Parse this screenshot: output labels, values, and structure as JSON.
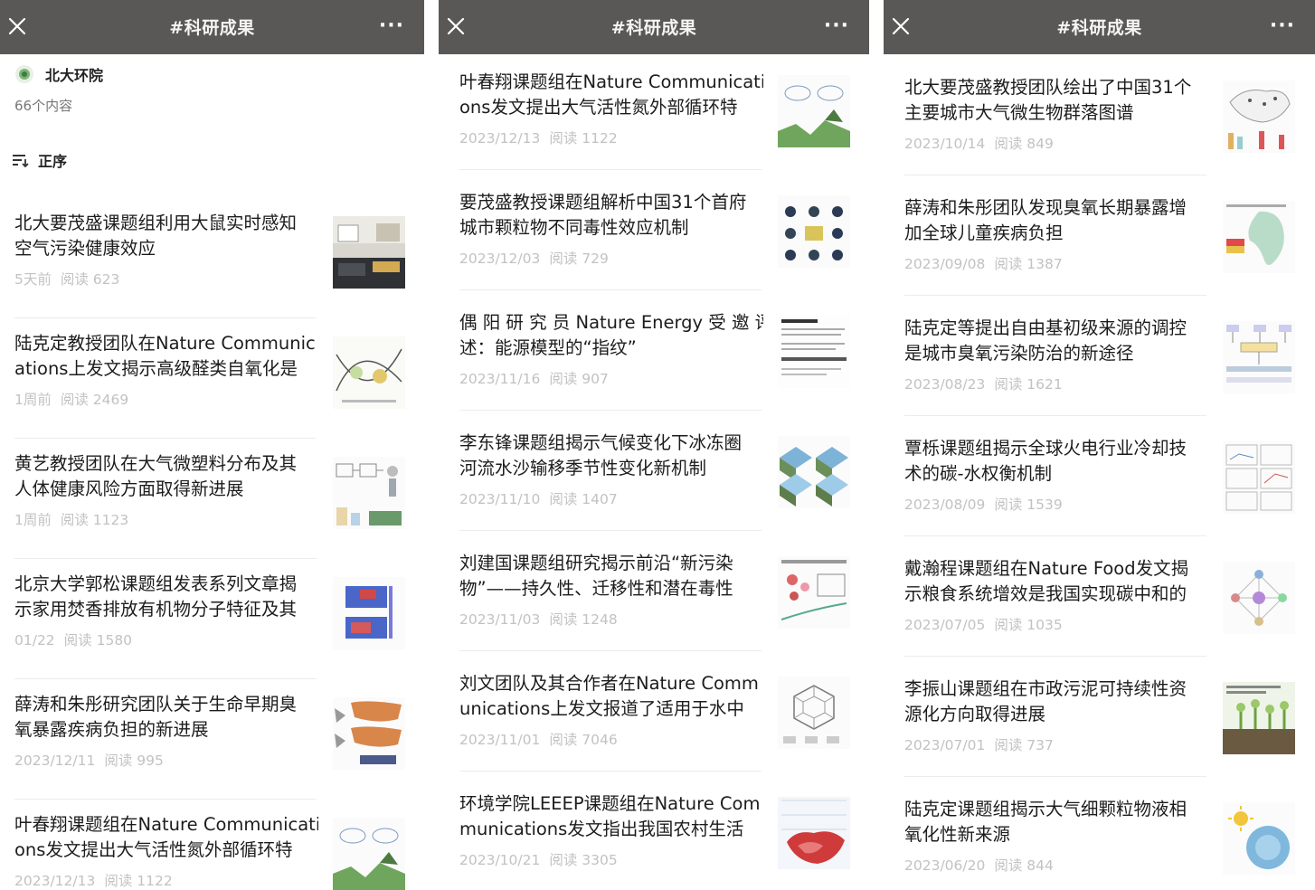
{
  "panels": [
    {
      "topbar": {
        "title": "#科研成果",
        "more": "···"
      },
      "account": {
        "name": "北大环院",
        "count": "66个内容",
        "sort_label": "正序"
      },
      "items": [
        {
          "title_lines": [
            "北大要茂盛课题组利用大鼠实时感知",
            "空气污染健康效应"
          ],
          "time": "5天前",
          "reads": "阅读 623",
          "thumb": "lab-photo"
        },
        {
          "title_lines": [
            "陆克定教授团队在Nature Communic",
            "ations上发文揭示高级醛类自氧化是"
          ],
          "time": "1周前",
          "reads": "阅读 2469",
          "thumb": "curve-diagram"
        },
        {
          "title_lines": [
            "黄艺教授团队在大气微塑料分布及其",
            "人体健康风险方面取得新进展"
          ],
          "time": "1周前",
          "reads": "阅读 1123",
          "thumb": "flow-diagram"
        },
        {
          "title_lines": [
            "北京大学郭松课题组发表系列文章揭",
            "示家用焚香排放有机物分子特征及其"
          ],
          "time": "01/22",
          "reads": "阅读 1580",
          "thumb": "heatmap"
        },
        {
          "title_lines": [
            "薛涛和朱彤研究团队关于生命早期臭",
            "氧暴露疾病负担的新进展"
          ],
          "time": "2023/12/11",
          "reads": "阅读 995",
          "thumb": "world-maps"
        },
        {
          "title_lines": [
            "叶春翔课题组在Nature Communicati",
            "ons发文提出大气活性氮外部循环特"
          ],
          "time": "2023/12/13",
          "reads": "阅读 1122",
          "thumb": "nitrogen-cycle"
        }
      ]
    },
    {
      "topbar": {
        "title": "#科研成果",
        "more": "···"
      },
      "items": [
        {
          "title_lines": [
            "叶春翔课题组在Nature Communicati",
            "ons发文提出大气活性氮外部循环特"
          ],
          "time": "2023/12/13",
          "reads": "阅读 1122",
          "thumb": "nitrogen-cycle"
        },
        {
          "title_lines": [
            "要茂盛教授课题组解析中国31个首府",
            "城市颗粒物不同毒性效应机制"
          ],
          "time": "2023/12/03",
          "reads": "阅读 729",
          "thumb": "particle-grid"
        },
        {
          "title_lines": [
            "偶 阳 研 究 员 Nature Energy 受 邀 评",
            "述：能源模型的“指纹”"
          ],
          "time": "2023/11/16",
          "reads": "阅读 907",
          "thumb": "journal-page"
        },
        {
          "title_lines": [
            "李东锋课题组揭示气候变化下冰冻圈",
            "河流水沙输移季节性变化新机制"
          ],
          "time": "2023/11/10",
          "reads": "阅读 1407",
          "thumb": "terrain-blocks"
        },
        {
          "title_lines": [
            "刘建国课题组研究揭示前沿“新污染",
            "物”——持久性、迁移性和潜在毒性"
          ],
          "time": "2023/11/03",
          "reads": "阅读 1248",
          "thumb": "pollutant-diagram"
        },
        {
          "title_lines": [
            "刘文团队及其合作者在Nature Comm",
            "unications上发文报道了适用于水中"
          ],
          "time": "2023/11/01",
          "reads": "阅读 7046",
          "thumb": "molecule-ring"
        },
        {
          "title_lines": [
            "环境学院LEEEP课题组在Nature Com",
            "munications发文指出我国农村生活"
          ],
          "time": "2023/10/21",
          "reads": "阅读 3305",
          "thumb": "china-map"
        }
      ]
    },
    {
      "topbar": {
        "title": "#科研成果",
        "more": "···"
      },
      "items": [
        {
          "title_lines": [
            "北大要茂盛教授团队绘出了中国31个",
            "主要城市大气微生物群落图谱"
          ],
          "time": "2023/10/14",
          "reads": "阅读 849",
          "thumb": "china-map-bars"
        },
        {
          "title_lines": [
            "薛涛和朱彤团队发现臭氧长期暴露增",
            "加全球儿童疾病负担"
          ],
          "time": "2023/09/08",
          "reads": "阅读 1387",
          "thumb": "africa-map"
        },
        {
          "title_lines": [
            "陆克定等提出自由基初级来源的调控",
            "是城市臭氧污染防治的新途径"
          ],
          "time": "2023/08/23",
          "reads": "阅读 1621",
          "thumb": "radical-flow"
        },
        {
          "title_lines": [
            "覃栎课题组揭示全球火电行业冷却技",
            "术的碳-水权衡机制"
          ],
          "time": "2023/08/09",
          "reads": "阅读 1539",
          "thumb": "panel-charts"
        },
        {
          "title_lines": [
            "戴瀚程课题组在Nature Food发文揭",
            "示粮食系统增效是我国实现碳中和的"
          ],
          "time": "2023/07/05",
          "reads": "阅读 1035",
          "thumb": "network-diagram"
        },
        {
          "title_lines": [
            "李振山课题组在市政污泥可持续性资",
            "源化方向取得进展"
          ],
          "time": "2023/07/01",
          "reads": "阅读 737",
          "thumb": "sludge-plants"
        },
        {
          "title_lines": [
            "陆克定课题组揭示大气细颗粒物液相",
            "氧化性新来源"
          ],
          "time": "2023/06/20",
          "reads": "阅读 844",
          "thumb": "droplet-sun"
        }
      ]
    }
  ],
  "colors": {
    "topbar": "#595857",
    "title": "#1c1c1c",
    "meta": "#c2c2c2",
    "separator": "#ececec"
  }
}
